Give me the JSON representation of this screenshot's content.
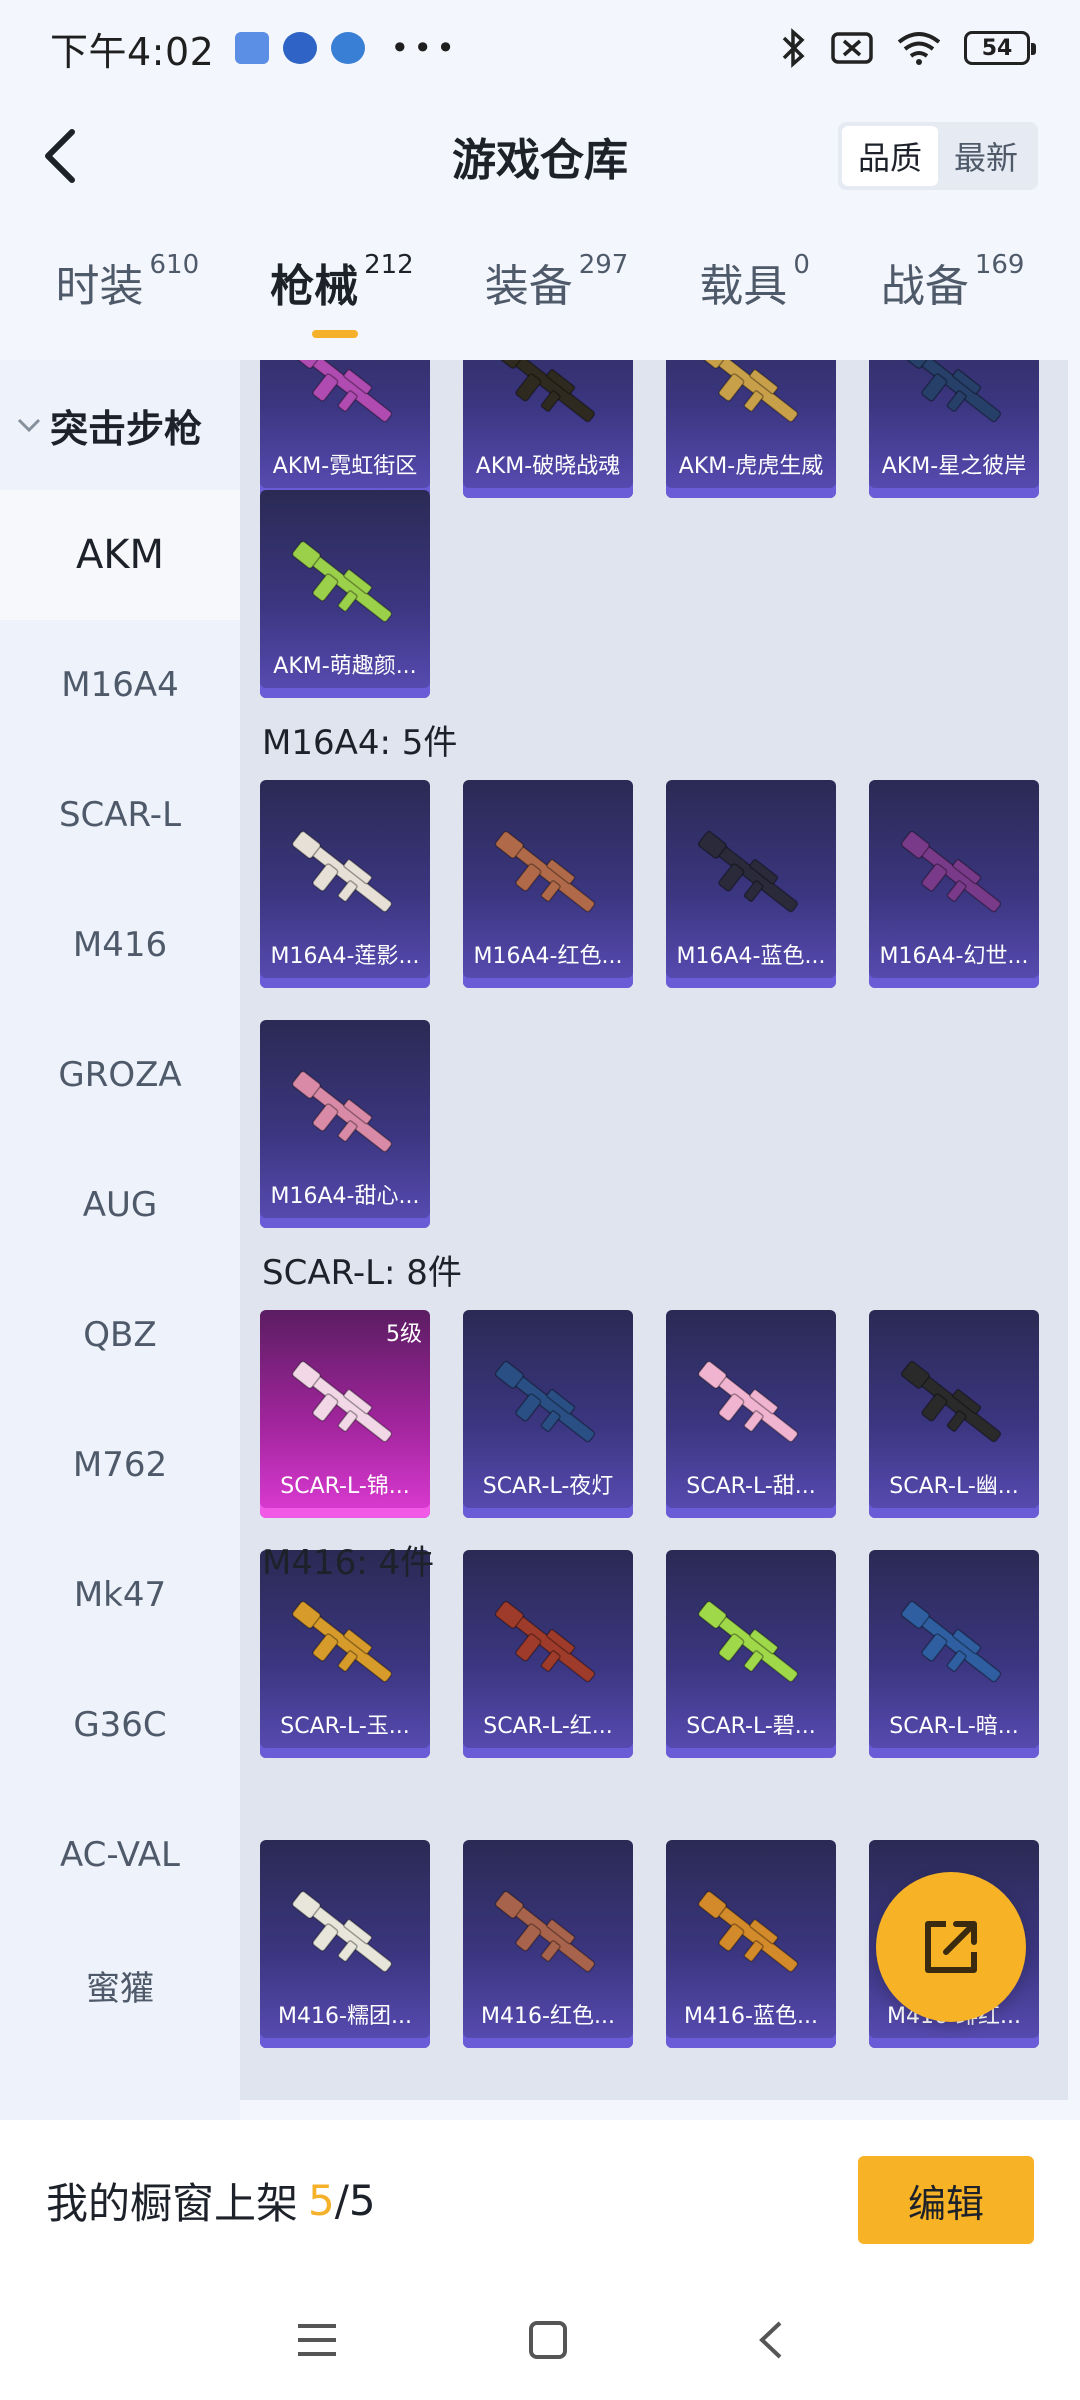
{
  "status_bar": {
    "time": "下午4:02",
    "dots": "•••",
    "battery": "54"
  },
  "header": {
    "title": "游戏仓库",
    "sort_options": [
      "品质",
      "最新"
    ],
    "sort_active": "品质"
  },
  "tabs": [
    {
      "label": "时装",
      "count": "610"
    },
    {
      "label": "枪械",
      "count": "212",
      "active": true
    },
    {
      "label": "装备",
      "count": "297"
    },
    {
      "label": "载具",
      "count": "0"
    },
    {
      "label": "战备",
      "count": "169"
    }
  ],
  "sidebar": {
    "group": "突击步枪",
    "items": [
      "AKM",
      "M16A4",
      "SCAR-L",
      "M416",
      "GROZA",
      "AUG",
      "QBZ",
      "M762",
      "Mk47",
      "G36C",
      "AC-VAL",
      "蜜獾"
    ],
    "active": "AKM"
  },
  "sections": [
    {
      "title": "",
      "items": [
        {
          "name": "AKM-霓虹街区",
          "color": "#b04bb2"
        },
        {
          "name": "AKM-破晓战魂",
          "color": "#2f2a1f"
        },
        {
          "name": "AKM-虎虎生威",
          "color": "#c9a04a"
        },
        {
          "name": "AKM-星之彼岸",
          "color": "#27406a"
        },
        {
          "name": "AKM-萌趣颜...",
          "color": "#9bd04b"
        }
      ]
    },
    {
      "title": "M16A4: 5件",
      "items": [
        {
          "name": "M16A4-莲影...",
          "color": "#e6e0d6"
        },
        {
          "name": "M16A4-红色...",
          "color": "#b06a4a"
        },
        {
          "name": "M16A4-蓝色...",
          "color": "#2a2a3a"
        },
        {
          "name": "M16A4-幻世...",
          "color": "#7a3a8a"
        },
        {
          "name": "M16A4-甜心...",
          "color": "#d98aa6"
        }
      ]
    },
    {
      "title": "SCAR-L: 8件",
      "items": [
        {
          "name": "SCAR-L-锦...",
          "color": "#f2d8e6",
          "grade": "5级",
          "gold": true
        },
        {
          "name": "SCAR-L-夜灯",
          "color": "#2a4f84"
        },
        {
          "name": "SCAR-L-甜...",
          "color": "#f0b3d0"
        },
        {
          "name": "SCAR-L-幽...",
          "color": "#2a2a2a"
        },
        {
          "name": "SCAR-L-玉...",
          "color": "#d79b2b"
        },
        {
          "name": "SCAR-L-红...",
          "color": "#9e3b2a"
        },
        {
          "name": "SCAR-L-碧...",
          "color": "#9fd94a"
        },
        {
          "name": "SCAR-L-暗...",
          "color": "#2f5fa0"
        }
      ]
    },
    {
      "title": "M416: 4件",
      "items": [
        {
          "name": "M416-糯团...",
          "color": "#e8e6da"
        },
        {
          "name": "M416-红色...",
          "color": "#a8634c"
        },
        {
          "name": "M416-蓝色...",
          "color": "#d38a2a"
        },
        {
          "name": "M416-绯红...",
          "color": "#7a3a6a"
        }
      ]
    }
  ],
  "bottom_bar": {
    "label": "我的橱窗上架",
    "used": "5",
    "separator": "/",
    "total": "5",
    "edit_label": "编辑"
  },
  "colors": {
    "accent": "#f7b225",
    "card_purple": "#4a3f9c",
    "card_gold": "#dd3bd4"
  }
}
